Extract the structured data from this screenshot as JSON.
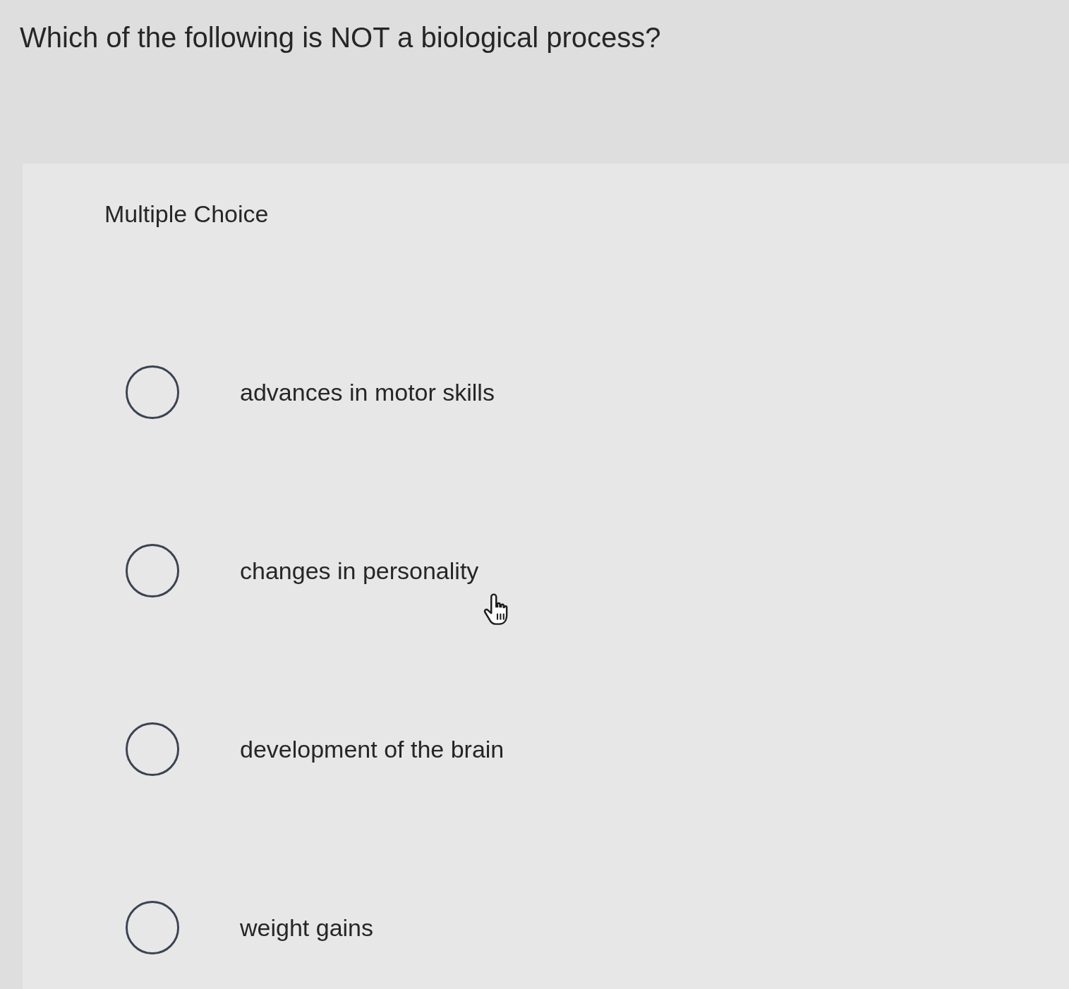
{
  "question": "Which of the following is NOT a biological process?",
  "panel": {
    "heading": "Multiple Choice",
    "options": [
      {
        "label": "advances in motor skills",
        "selected": false
      },
      {
        "label": "changes in personality",
        "selected": false
      },
      {
        "label": "development of the brain",
        "selected": false
      },
      {
        "label": "weight gains",
        "selected": false
      }
    ]
  }
}
